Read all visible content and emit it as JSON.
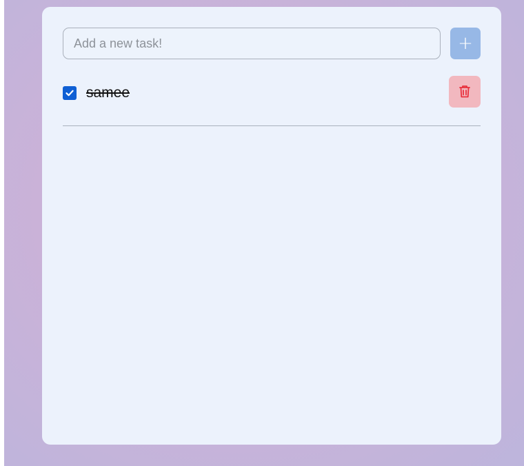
{
  "input": {
    "placeholder": "Add a new task!",
    "value": ""
  },
  "add_button": {
    "label": "+",
    "color": "#97b8e6"
  },
  "tasks": [
    {
      "text": "samee",
      "completed": true,
      "delete_icon": "trash-icon",
      "delete_color": "#f2b8bf"
    }
  ],
  "colors": {
    "card": "#ecf2fc",
    "checkbox": "#0f5fd4",
    "trash": "#e8303d"
  }
}
